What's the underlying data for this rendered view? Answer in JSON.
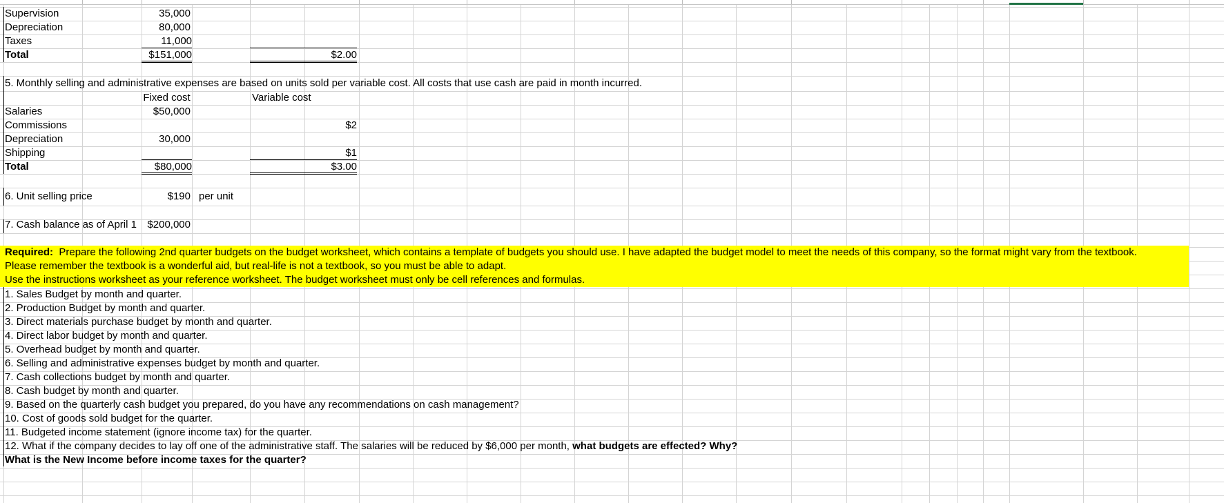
{
  "overhead": {
    "rows": [
      {
        "label": "Supervision",
        "fixed": "35,000"
      },
      {
        "label": "Depreciation",
        "fixed": "80,000"
      },
      {
        "label": "Taxes",
        "fixed": "11,000"
      }
    ],
    "total_label": "Total",
    "total_fixed": "$151,000",
    "total_variable": "$2.00"
  },
  "selling": {
    "intro": "5. Monthly selling and administrative expenses are based on units sold per variable cost.  All costs that use cash are paid in month incurred.",
    "fixed_header": "Fixed cost",
    "variable_header": "Variable cost",
    "rows": [
      {
        "label": "Salaries",
        "fixed": "$50,000",
        "variable": ""
      },
      {
        "label": "Commissions",
        "fixed": "",
        "variable": "$2"
      },
      {
        "label": "Depreciation",
        "fixed": "30,000",
        "variable": ""
      },
      {
        "label": "Shipping",
        "fixed": "",
        "variable": "$1"
      }
    ],
    "total_label": "Total",
    "total_fixed": "$80,000",
    "total_variable": "$3.00"
  },
  "price": {
    "label": "6. Unit selling price",
    "value": "$190",
    "unit": "per unit"
  },
  "cash": {
    "label": "7. Cash balance as of April 1",
    "value": "$200,000"
  },
  "required": {
    "bold_label": "Required:",
    "line1": "Prepare the following 2nd quarter budgets on the budget worksheet, which contains a template of budgets you should use.  I have adapted the budget model to meet the needs of this company, so the format might vary from the textbook.",
    "line2": "Please remember the textbook is a wonderful aid, but real-life is not a textbook, so you must be able to adapt.",
    "line3": "Use the instructions worksheet as your reference worksheet.   The budget worksheet must only be cell references and formulas."
  },
  "tasks": [
    "1.  Sales Budget by month and quarter.",
    "2.  Production Budget by month and quarter.",
    "3.  Direct materials purchase budget by month and quarter.",
    "4.  Direct labor budget by month and quarter.",
    "5.  Overhead budget by month and quarter.",
    "6.  Selling and administrative expenses budget by month and quarter.",
    "7.  Cash collections budget by month and quarter.",
    "8. Cash budget by month and quarter.",
    "9.  Based on the quarterly cash budget you prepared, do you have any recommendations on cash management?",
    "10.  Cost of goods sold budget for the quarter.",
    "11.  Budgeted income statement (ignore income tax) for the quarter."
  ],
  "task12": {
    "text": "12.  What if the company decides to lay off one of the administrative staff.  The salaries will be reduced by $6,000 per month, ",
    "bold": "what budgets are effected? Why?"
  },
  "final_question": "What is the New Income before income taxes for the quarter?"
}
